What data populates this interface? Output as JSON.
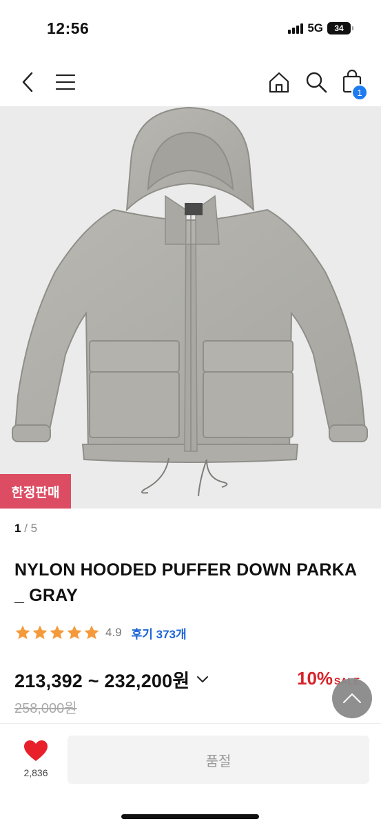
{
  "status_bar": {
    "time": "12:56",
    "network": "5G",
    "battery": "34"
  },
  "nav": {
    "back_icon": "chevron-left-icon",
    "menu_icon": "hamburger-menu-icon",
    "home_icon": "home-icon",
    "search_icon": "search-icon",
    "cart_icon": "shopping-bag-icon",
    "cart_count": "1"
  },
  "product": {
    "image_alt_icon": "gray-puffer-jacket-image",
    "badge": "한정판매",
    "page_current": "1",
    "page_separator": "/",
    "page_total": "5",
    "title": "NYLON HOODED PUFFER DOWN PARKA _ GRAY",
    "rating_value": "4.9",
    "rating_stars": 5,
    "review_label": "후기 373개",
    "price_range": "213,392 ~ 232,200원",
    "original_price": "258,000원",
    "discount_percent": "10%",
    "discount_tag": "SALE"
  },
  "bottom_bar": {
    "like_count": "2,836",
    "soldout_label": "품절"
  },
  "colors": {
    "accent_blue": "#1b64d6",
    "badge_pink": "#dc4d63",
    "sale_red": "#d8232a",
    "star_orange": "#f59a3a",
    "heart_red": "#e8202a"
  }
}
